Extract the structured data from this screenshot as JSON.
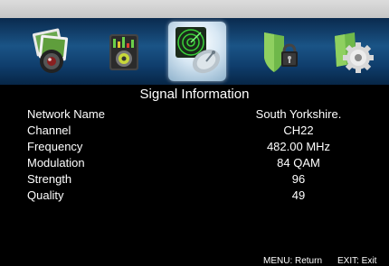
{
  "menu": {
    "items": [
      {
        "icon": "photo-icon"
      },
      {
        "icon": "music-player-icon"
      },
      {
        "icon": "satellite-signal-icon",
        "selected": true
      },
      {
        "icon": "security-lock-icon"
      },
      {
        "icon": "settings-gear-icon"
      }
    ]
  },
  "panel": {
    "title": "Signal Information",
    "rows": [
      {
        "label": "Network Name",
        "value": "South Yorkshire."
      },
      {
        "label": "Channel",
        "value": "CH22"
      },
      {
        "label": "Frequency",
        "value": "482.00 MHz"
      },
      {
        "label": "Modulation",
        "value": "84 QAM"
      },
      {
        "label": "Strength",
        "value": "96"
      },
      {
        "label": "Quality",
        "value": "49"
      }
    ]
  },
  "footer": {
    "menu_hint": "MENU: Return",
    "exit_hint": "EXIT: Exit"
  },
  "colors": {
    "background": "#000000",
    "menu_bar": "#1a5486",
    "top_bar": "#d0d0d0",
    "text": "#ffffff"
  }
}
